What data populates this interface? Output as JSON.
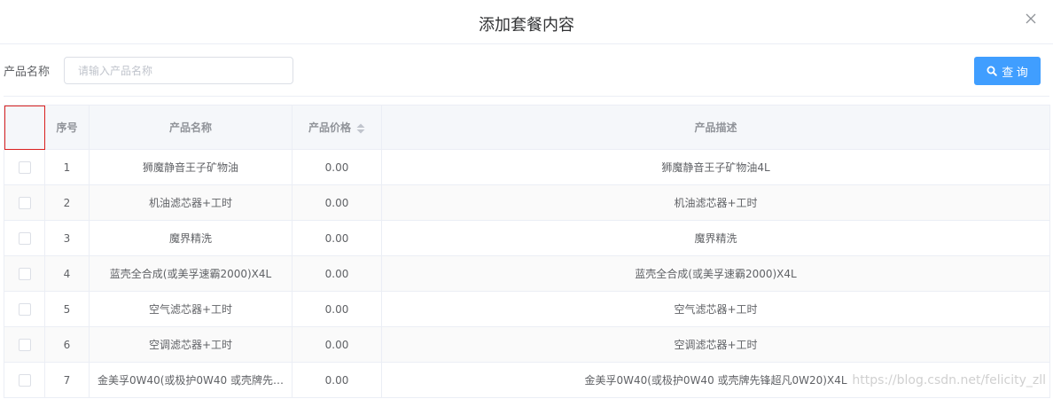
{
  "dialog": {
    "title": "添加套餐内容"
  },
  "search": {
    "label": "产品名称",
    "placeholder": "请输入产品名称",
    "value": "",
    "button_label": "查 询"
  },
  "table": {
    "headers": {
      "index": "序号",
      "name": "产品名称",
      "price": "产品价格",
      "description": "产品描述"
    },
    "rows": [
      {
        "index": "1",
        "name": "狮魔静音王子矿物油",
        "price": "0.00",
        "description": "狮魔静音王子矿物油4L"
      },
      {
        "index": "2",
        "name": "机油滤芯器+工时",
        "price": "0.00",
        "description": "机油滤芯器+工时"
      },
      {
        "index": "3",
        "name": "魔界精洗",
        "price": "0.00",
        "description": "魔界精洗"
      },
      {
        "index": "4",
        "name": "蓝壳全合成(或美孚速霸2000)X4L",
        "price": "0.00",
        "description": "蓝壳全合成(或美孚速霸2000)X4L"
      },
      {
        "index": "5",
        "name": "空气滤芯器+工时",
        "price": "0.00",
        "description": "空气滤芯器+工时"
      },
      {
        "index": "6",
        "name": "空调滤芯器+工时",
        "price": "0.00",
        "description": "空调滤芯器+工时"
      },
      {
        "index": "7",
        "name": "金美孚0W40(或极护0W40 或壳牌先…",
        "price": "0.00",
        "description": "金美孚0W40(或极护0W40 或壳牌先锋超凡0W20)X4L"
      }
    ]
  },
  "watermark": {
    "text": "https://blog.csdn.net/felicity_zll"
  },
  "colors": {
    "primary": "#409eff",
    "selection_outline": "#d9201f"
  },
  "icons": {
    "close": "close-icon",
    "search": "search-icon",
    "sort": "sort-caret-icon",
    "checkbox": "checkbox-icon"
  }
}
